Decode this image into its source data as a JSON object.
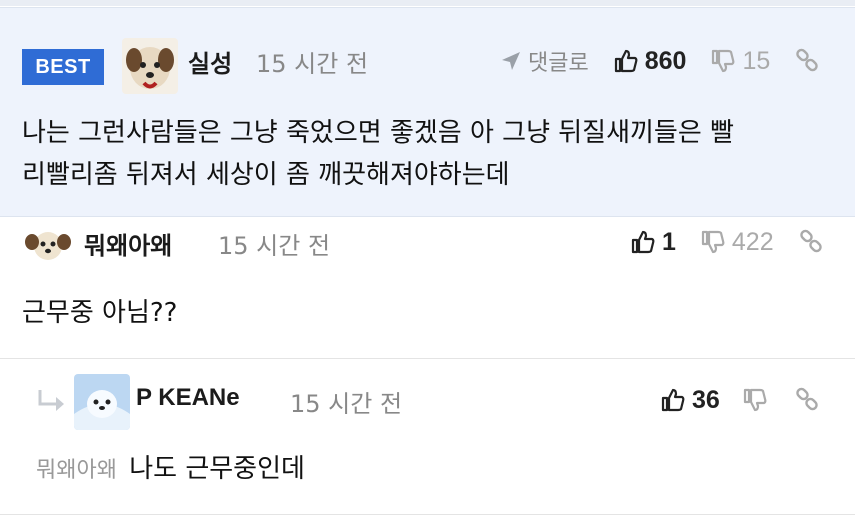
{
  "best_comment": {
    "badge": "BEST",
    "nickname": "실성",
    "time": "15 시간 전",
    "reply_label": "댓글로",
    "likes": "860",
    "dislikes": "15",
    "text_line1": "나는 그런사람들은 그냥 죽었으면 좋겠음 아 그냥 뒤질새끼들은 빨",
    "text_line2": "리빨리좀 뒤져서 세상이 좀 깨끗해져야하는데"
  },
  "comment2": {
    "nickname": "뭐왜아왜",
    "time": "15 시간 전",
    "likes": "1",
    "dislikes": "422",
    "text": "근무중 아님??"
  },
  "reply": {
    "nickname": "P KEANe",
    "time": "15 시간 전",
    "likes": "36",
    "mention": "뭐왜아왜",
    "text": "나도 근무중인데"
  },
  "colors": {
    "best_badge": "#2f6cd5",
    "best_background": "#eef3fc",
    "muted": "#aaaaaa"
  },
  "icons": [
    "thumbs-up-icon",
    "thumbs-down-icon",
    "share-link-icon",
    "reply-arrow-icon",
    "reply-indent-icon"
  ]
}
